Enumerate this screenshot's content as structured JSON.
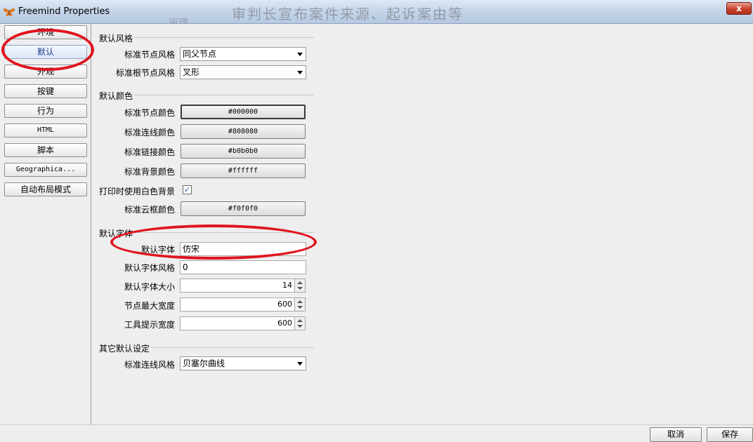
{
  "window": {
    "title": "Freemind Properties",
    "close_label": "x",
    "background_text_1": "审判长宣布案件来源、起诉案由等",
    "background_text_2": "审理"
  },
  "nav": {
    "items": [
      {
        "label": "环境"
      },
      {
        "label": "默认"
      },
      {
        "label": "外观"
      },
      {
        "label": "按键"
      },
      {
        "label": "行为"
      },
      {
        "label": "HTML"
      },
      {
        "label": "脚本"
      },
      {
        "label": "Geographica..."
      },
      {
        "label": "自动布局模式"
      }
    ],
    "selected": "默认"
  },
  "sections": {
    "style": {
      "title": "默认风格",
      "node_style_label": "标准节点风格",
      "node_style_value": "同父节点",
      "root_style_label": "标准根节点风格",
      "root_style_value": "叉形"
    },
    "colors": {
      "title": "默认颜色",
      "node_color_label": "标准节点颜色",
      "node_color_value": "#000000",
      "edge_color_label": "标准连线颜色",
      "edge_color_value": "#808080",
      "link_color_label": "标准链接颜色",
      "link_color_value": "#b0b0b0",
      "bg_color_label": "标准背景颜色",
      "bg_color_value": "#ffffff",
      "print_white_label": "打印时使用白色背景",
      "print_white_checked": "✓",
      "cloud_color_label": "标准云框颜色",
      "cloud_color_value": "#f0f0f0"
    },
    "font": {
      "title": "默认字体",
      "font_label": "默认字体",
      "font_value": "仿宋",
      "font_style_label": "默认字体风格",
      "font_style_value": "0",
      "font_size_label": "默认字体大小",
      "font_size_value": "14",
      "node_max_width_label": "节点最大宽度",
      "node_max_width_value": "600",
      "tooltip_width_label": "工具提示宽度",
      "tooltip_width_value": "600"
    },
    "other": {
      "title": "其它默认设定",
      "edge_style_label": "标准连线风格",
      "edge_style_value": "贝塞尔曲线"
    }
  },
  "footer": {
    "cancel_label": "取消",
    "save_label": "保存"
  },
  "colors": {
    "highlight_ring": "#e0141e",
    "titlebar": "#c6d6ea"
  }
}
